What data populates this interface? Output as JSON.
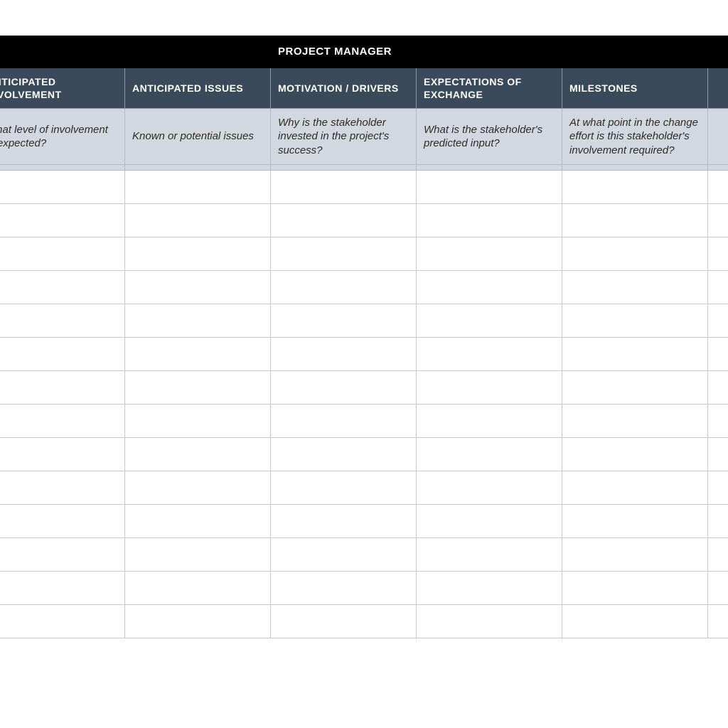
{
  "section_title": "PROJECT MANAGER",
  "columns": [
    {
      "header": "ANTICIPATED INVOLVEMENT",
      "desc": "What level of involvement is expected?"
    },
    {
      "header": "ANTICIPATED ISSUES",
      "desc": "Known or potential issues"
    },
    {
      "header": "MOTIVATION / DRIVERS",
      "desc": "Why is the stakeholder invested in the project's success?"
    },
    {
      "header": "EXPECTATIONS OF EXCHANGE",
      "desc": "What is the stakeholder's predicted input?"
    },
    {
      "header": "MILESTONES",
      "desc": "At what point in the change effort is this stakeholder's involvement required?"
    }
  ],
  "empty_rows": 14
}
